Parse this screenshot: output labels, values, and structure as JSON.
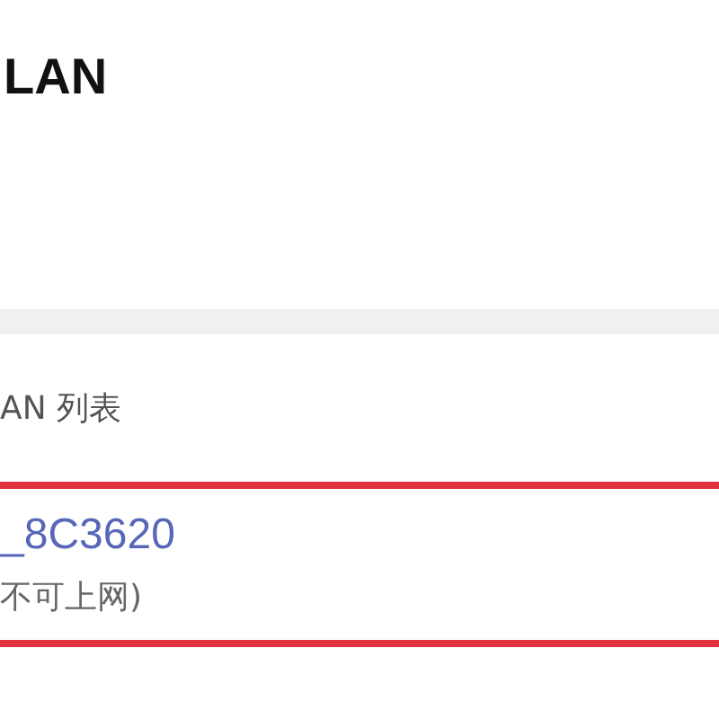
{
  "header": {
    "title": "LAN"
  },
  "section": {
    "label": "AN 列表"
  },
  "networks": [
    {
      "name": "_8C3620",
      "status": "不可上网)",
      "highlighted": true
    }
  ]
}
